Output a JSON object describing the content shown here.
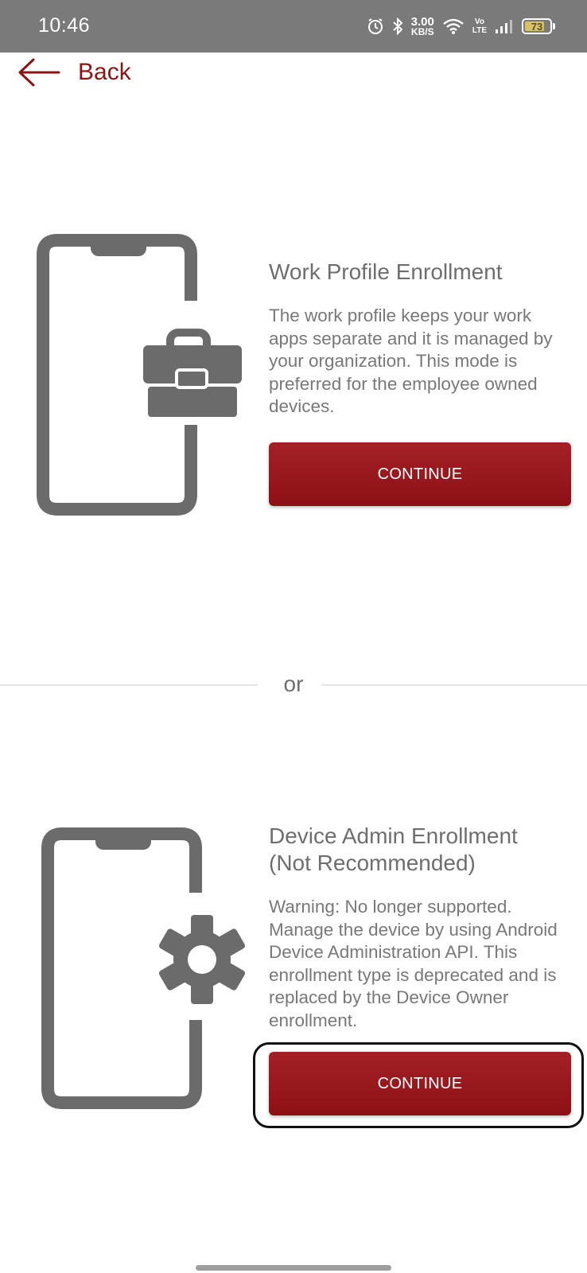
{
  "status_bar": {
    "time": "10:46",
    "network_speed_value": "3.00",
    "network_speed_unit": "KB/S",
    "volte_top": "Vo",
    "volte_bottom": "LTE",
    "battery_level": "73",
    "icons": [
      "alarm-icon",
      "bluetooth-icon",
      "wifi-icon",
      "signal-icon",
      "battery-icon"
    ]
  },
  "nav": {
    "back_label": "Back"
  },
  "work_profile": {
    "title": "Work Profile Enrollment",
    "description": "The work profile keeps your work apps separate and it is managed by your organization. This mode is preferred for the employee owned devices.",
    "button_label": "CONTINUE",
    "icon": "briefcase-phone-icon"
  },
  "separator": {
    "label": "or"
  },
  "device_admin": {
    "title": "Device Admin Enrollment (Not Recommended)",
    "description": "Warning: No longer supported. Manage the device by using Android Device Administration API. This enrollment type is deprecated and is replaced by the Device Owner enrollment.",
    "button_label": "CONTINUE",
    "icon": "gear-phone-icon"
  },
  "colors": {
    "accent": "#8b1513",
    "button": "#9a1a1e",
    "status_bar": "#7a7a7a",
    "icon_gray": "#6b6b6b",
    "text_gray": "#6e6e6e"
  }
}
